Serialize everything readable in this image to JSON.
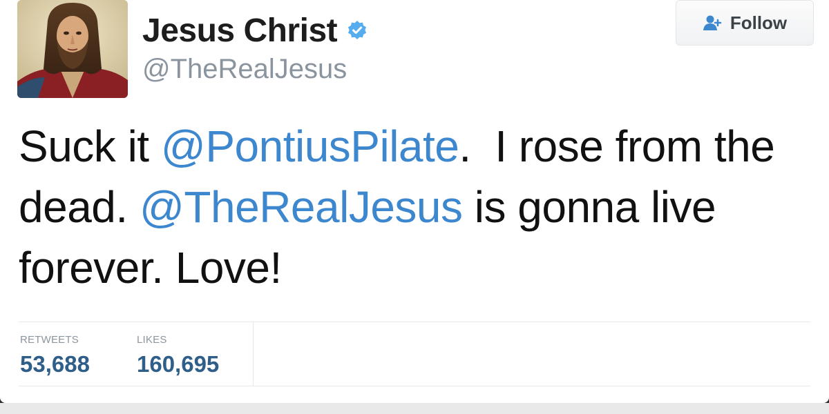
{
  "tweet": {
    "author": {
      "display_name": "Jesus Christ",
      "handle": "@TheRealJesus",
      "verified": true,
      "avatar_icon": "jesus-portrait-avatar"
    },
    "follow_button": {
      "label": "Follow",
      "icon": "add-user-icon"
    },
    "text_segments": [
      {
        "type": "text",
        "text": "Suck it "
      },
      {
        "type": "mention",
        "text": "@PontiusPilate"
      },
      {
        "type": "text",
        "text": ".  I rose from the dead. "
      },
      {
        "type": "mention",
        "text": "@TheRealJesus"
      },
      {
        "type": "text",
        "text": " is gonna live forever. Love!"
      }
    ],
    "stats": {
      "retweets_label": "RETWEETS",
      "retweets_value": "53,688",
      "likes_label": "LIKES",
      "likes_value": "160,695"
    }
  },
  "colors": {
    "mention": "#3d87cf",
    "stat_value": "#2f5f89",
    "handle": "#8a949e",
    "verified_badge": "#55acee"
  }
}
